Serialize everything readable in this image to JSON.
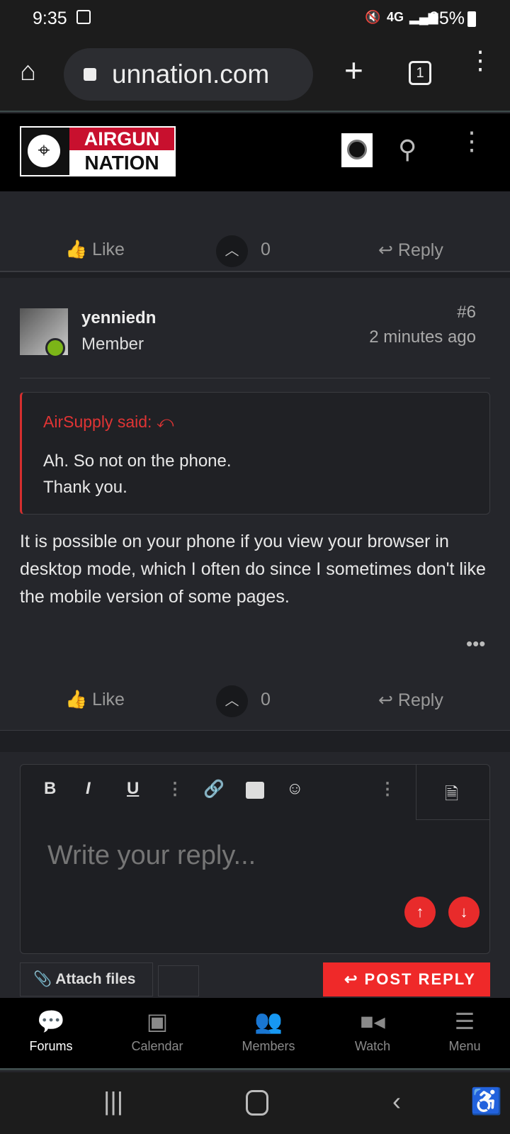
{
  "status": {
    "time": "9:35",
    "battery": "95%",
    "network": "4G"
  },
  "browser": {
    "url": "unnation.com",
    "tab_count": "1"
  },
  "site": {
    "logo_top": "AIRGUN",
    "logo_bottom": "NATION"
  },
  "prev_post": {
    "like": "Like",
    "votes": "0",
    "reply": "Reply"
  },
  "post": {
    "author": "yenniedn",
    "role": "Member",
    "number": "#6",
    "time": "2 minutes ago",
    "quote_author": "AirSupply said:",
    "quote_lines": [
      "Ah. So not on the phone.",
      "Thank you."
    ],
    "body": "It is possible on your phone if you view your browser in desktop mode, which I often do since I sometimes don't like the mobile version of some pages.",
    "like": "Like",
    "votes": "0",
    "reply": "Reply"
  },
  "editor": {
    "placeholder": "Write your reply...",
    "bold": "B",
    "italic": "I",
    "underline": "U",
    "attach": "Attach files",
    "post_reply": "POST REPLY"
  },
  "nav": [
    {
      "label": "Forums",
      "icon": "speech-bubble-icon",
      "active": true
    },
    {
      "label": "Calendar",
      "icon": "calendar-icon"
    },
    {
      "label": "Members",
      "icon": "members-icon"
    },
    {
      "label": "Watch",
      "icon": "video-icon"
    },
    {
      "label": "Menu",
      "icon": "hamburger-icon"
    }
  ],
  "colors": {
    "accent": "#e82b2b",
    "background": "#25262b"
  }
}
